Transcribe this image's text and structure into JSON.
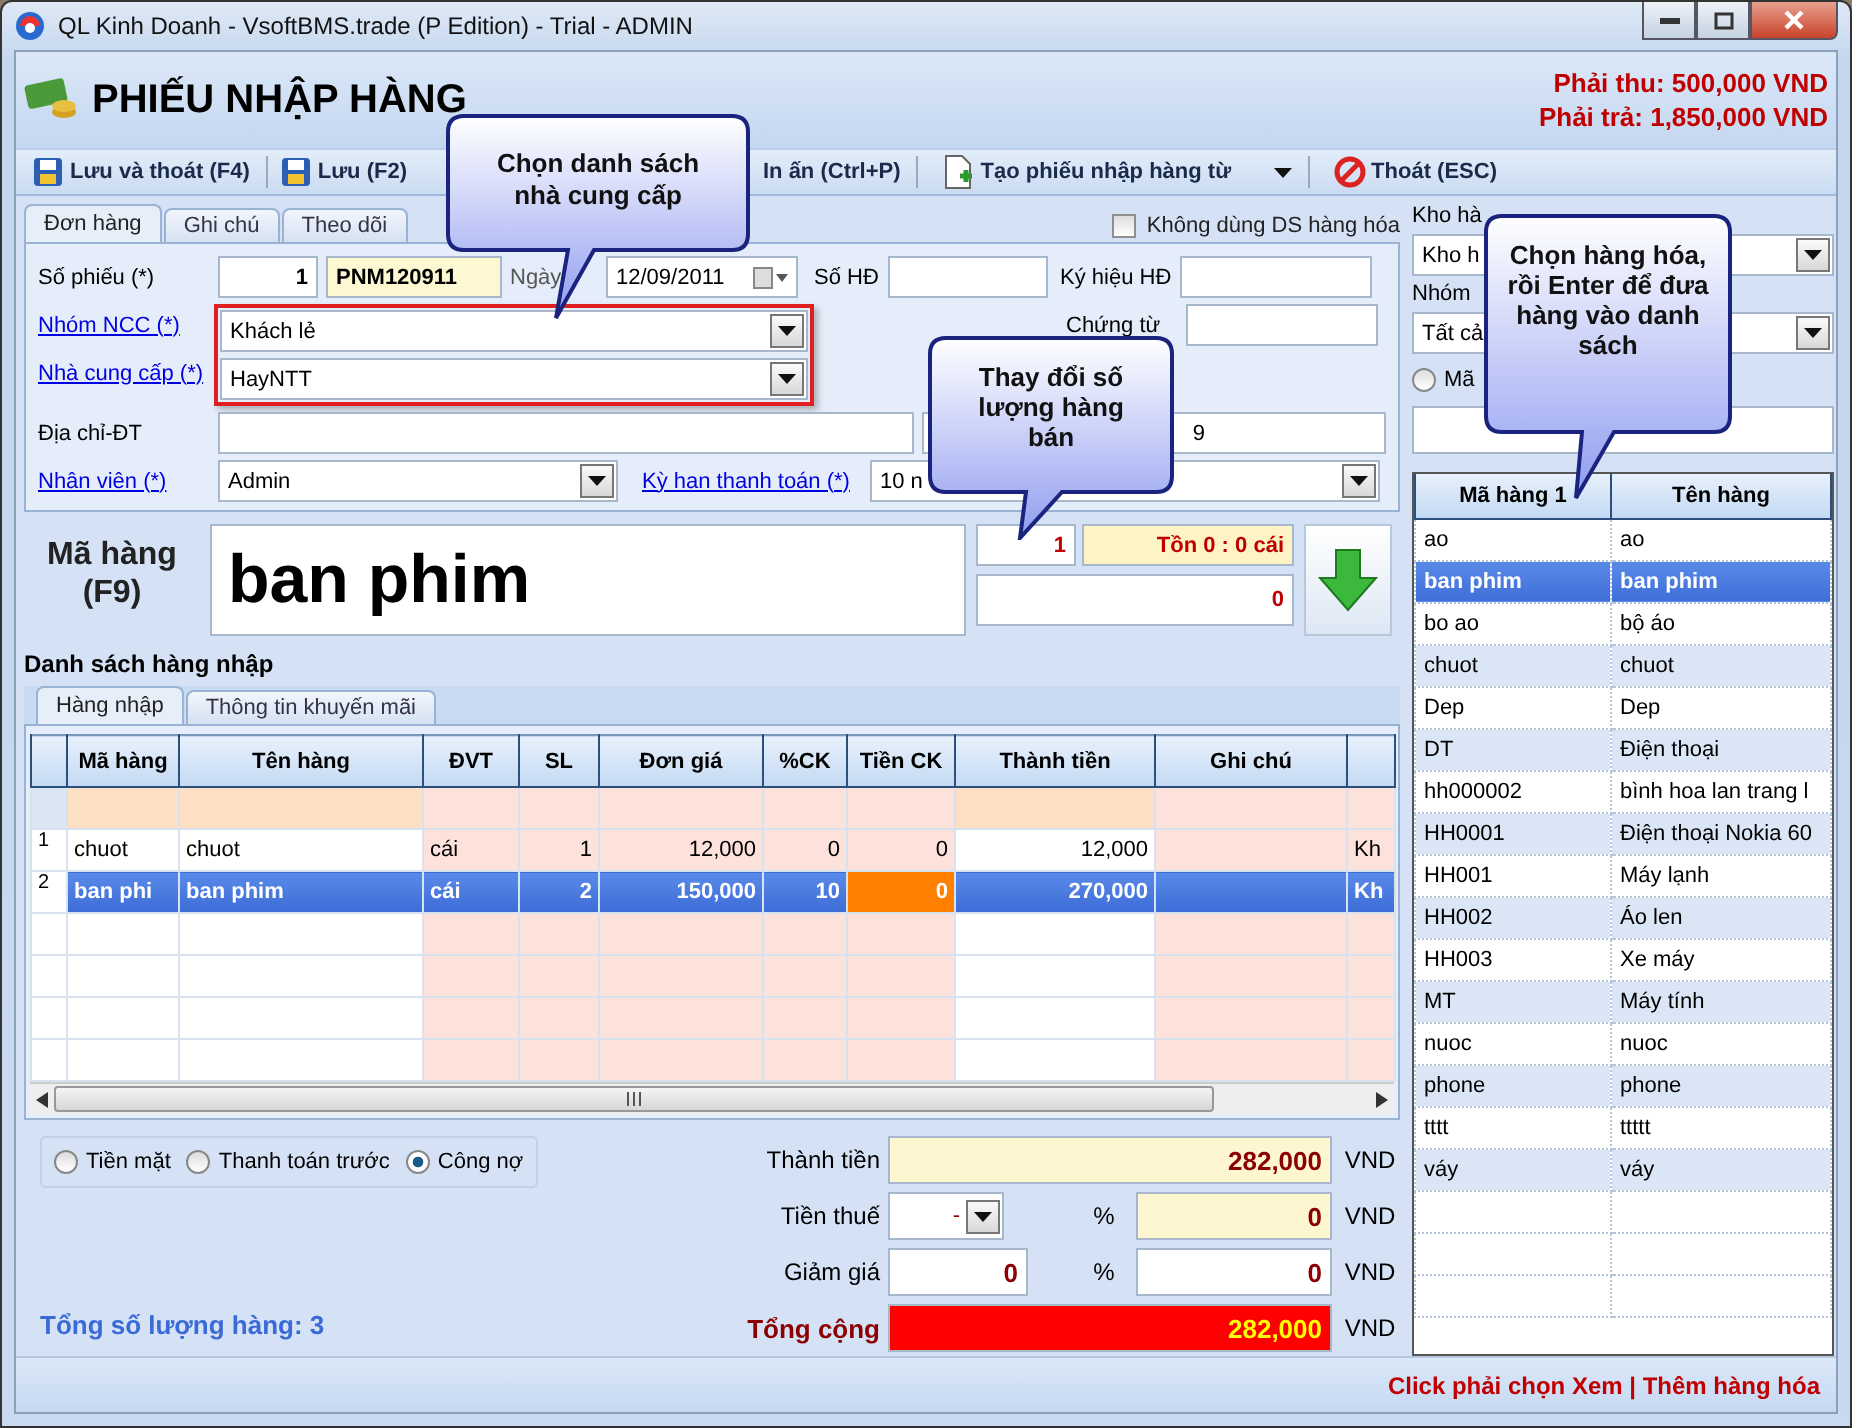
{
  "window": {
    "title": "QL Kinh Doanh - VsoftBMS.trade (P Edition) - Trial - ADMIN"
  },
  "header": {
    "title": "PHIẾU NHẬP HÀNG",
    "receivable": "Phải thu: 500,000 VND",
    "payable": "Phải trả: 1,850,000 VND"
  },
  "toolbar": [
    {
      "label": "Lưu và thoát (F4)",
      "kind": "save"
    },
    {
      "label": "Lưu (F2)",
      "kind": "save"
    },
    {
      "label": "In ấn (Ctrl+P)",
      "kind": "plain"
    },
    {
      "label": "Tạo phiếu nhập hàng từ",
      "kind": "create"
    },
    {
      "label": "Thoát (ESC)",
      "kind": "exit"
    }
  ],
  "form_tabs": [
    {
      "label": "Đơn hàng",
      "selected": true
    },
    {
      "label": "Ghi chú",
      "selected": false
    },
    {
      "label": "Theo dõi",
      "selected": false
    }
  ],
  "no_item_list": {
    "label": "Không dùng DS hàng hóa",
    "checked": false
  },
  "form": {
    "voucher_label": "Số phiếu (*)",
    "voucher_no": "1",
    "voucher_code": "PNM120911",
    "date_label": "Ngày",
    "date": "12/09/2011",
    "invoice_label": "Số HĐ",
    "symbol_label": "Ký hiệu HĐ",
    "document_label": "Chứng từ",
    "group_label": "Nhóm NCC (*)",
    "group": "Khách lẻ",
    "supplier_label": "Nhà cung cấp (*)",
    "supplier": "HayNTT",
    "address_label": "Địa chỉ-ĐT",
    "phone": "9",
    "staff_label": "Nhân viên (*)",
    "staff": "Admin",
    "term_label": "Kỳ han thanh toán (*)",
    "term": "10 n"
  },
  "item_entry": {
    "label": "Mã hàng",
    "hotkey": "(F9)",
    "code": "ban phim",
    "qty": "1",
    "stock": "Tồn 0 : 0 cái",
    "price": "0"
  },
  "list_title": "Danh sách hàng nhập",
  "grid_tabs": [
    {
      "label": "Hàng nhập",
      "selected": true
    },
    {
      "label": "Thông tin khuyến mãi",
      "selected": false
    }
  ],
  "grid_columns": [
    "Mã hàng",
    "Tên hàng",
    "ĐVT",
    "SL",
    "Đơn giá",
    "%CK",
    "Tiền CK",
    "Thành tiền",
    "Ghi chú"
  ],
  "grid_rows": [
    {
      "no": "1",
      "code": "chuot",
      "name": "chuot",
      "unit": "cái",
      "qty": "1",
      "price": "12,000",
      "disc_pct": "0",
      "disc_amt": "0",
      "amount": "12,000",
      "column_10": "Kh",
      "selected": false,
      "editing": false
    },
    {
      "no": "2",
      "code": "ban phi",
      "name": "ban phim",
      "unit": "cái",
      "qty": "2",
      "price": "150,000",
      "disc_pct": "10",
      "disc_amt": "0",
      "amount": "270,000",
      "column_10": "Kh",
      "selected": true,
      "editing": true
    }
  ],
  "payment": [
    {
      "label": "Tiền mặt",
      "selected": false
    },
    {
      "label": "Thanh toán trước",
      "selected": false
    },
    {
      "label": "Công nợ",
      "selected": true
    }
  ],
  "total_qty": "Tổng số lượng hàng: 3",
  "totals": {
    "subtotal_label": "Thành tiền",
    "subtotal": "282,000",
    "tax_label": "Tiền thuế",
    "tax_rate": "-",
    "tax": "0",
    "discount_label": "Giảm giá",
    "discount_pct": "0",
    "discount": "0",
    "total_label": "Tổng cộng",
    "total": "282,000",
    "percent": [
      "%",
      "%"
    ],
    "currency": [
      "VND",
      "VND",
      "VND",
      "VND"
    ]
  },
  "side": {
    "warehouse_label": "Kho hà",
    "warehouse": "Kho h",
    "group_label": "Nhóm",
    "group": "Tất cả",
    "search_mode": {
      "label": "Mã",
      "selected": false
    },
    "columns": [
      "Mã hàng 1",
      "Tên hàng"
    ],
    "rows": [
      {
        "code": "ao",
        "name": "ao",
        "selected": false
      },
      {
        "code": "ban phim",
        "name": "ban phim",
        "selected": true
      },
      {
        "code": "bo ao",
        "name": "bộ áo",
        "selected": false
      },
      {
        "code": "chuot",
        "name": "chuot",
        "selected": false
      },
      {
        "code": "Dep",
        "name": "Dep",
        "selected": false
      },
      {
        "code": "DT",
        "name": "Điện thoại",
        "selected": false
      },
      {
        "code": "hh000002",
        "name": "bình hoa lan trang l",
        "selected": false
      },
      {
        "code": "HH0001",
        "name": "Điện thoại Nokia 60",
        "selected": false
      },
      {
        "code": "HH001",
        "name": "Máy lạnh",
        "selected": false
      },
      {
        "code": "HH002",
        "name": "Áo len",
        "selected": false
      },
      {
        "code": "HH003",
        "name": "Xe máy",
        "selected": false
      },
      {
        "code": "MT",
        "name": "Máy tính",
        "selected": false
      },
      {
        "code": "nuoc",
        "name": "nuoc",
        "selected": false
      },
      {
        "code": "phone",
        "name": "phone",
        "selected": false
      },
      {
        "code": "tttt",
        "name": "ttttt",
        "selected": false
      },
      {
        "code": "váy",
        "name": "váy",
        "selected": false
      }
    ]
  },
  "status": "Click phải chọn Xem | Thêm hàng hóa",
  "callouts": [
    "Chọn danh sách nhà cung cấp",
    "Chọn hàng hóa, rồi Enter để đưa hàng vào danh sách",
    "Thay đổi số lượng hàng bán"
  ]
}
